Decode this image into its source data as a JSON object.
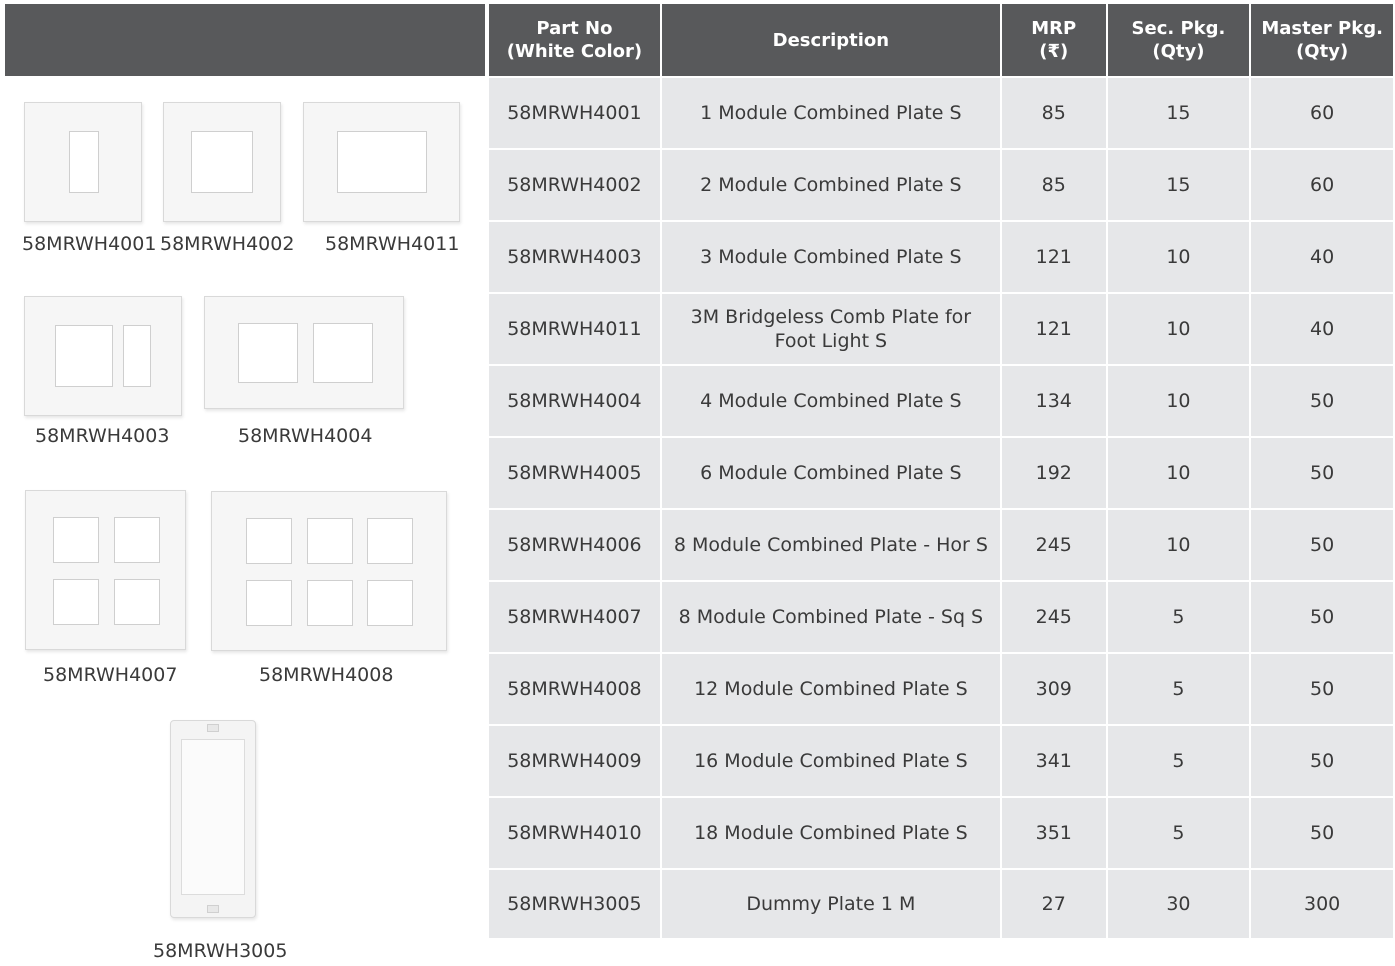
{
  "table": {
    "headers": {
      "part_no": "Part No\n(White Color)",
      "description": "Description",
      "mrp": "MRP\n(₹)",
      "sec_pkg": "Sec. Pkg.\n(Qty)",
      "master_pkg": "Master Pkg.\n(Qty)"
    },
    "rows": [
      {
        "part_no": "58MRWH4001",
        "description": "1 Module Combined Plate S",
        "mrp": "85",
        "sec_pkg": "15",
        "master_pkg": "60"
      },
      {
        "part_no": "58MRWH4002",
        "description": "2 Module Combined Plate S",
        "mrp": "85",
        "sec_pkg": "15",
        "master_pkg": "60"
      },
      {
        "part_no": "58MRWH4003",
        "description": "3 Module Combined Plate S",
        "mrp": "121",
        "sec_pkg": "10",
        "master_pkg": "40"
      },
      {
        "part_no": "58MRWH4011",
        "description": "3M Bridgeless Comb Plate for Foot Light S",
        "mrp": "121",
        "sec_pkg": "10",
        "master_pkg": "40"
      },
      {
        "part_no": "58MRWH4004",
        "description": "4 Module Combined Plate S",
        "mrp": "134",
        "sec_pkg": "10",
        "master_pkg": "50"
      },
      {
        "part_no": "58MRWH4005",
        "description": "6 Module Combined Plate S",
        "mrp": "192",
        "sec_pkg": "10",
        "master_pkg": "50"
      },
      {
        "part_no": "58MRWH4006",
        "description": "8 Module Combined Plate - Hor S",
        "mrp": "245",
        "sec_pkg": "10",
        "master_pkg": "50"
      },
      {
        "part_no": "58MRWH4007",
        "description": "8 Module Combined Plate - Sq S",
        "mrp": "245",
        "sec_pkg": "5",
        "master_pkg": "50"
      },
      {
        "part_no": "58MRWH4008",
        "description": "12 Module Combined Plate S",
        "mrp": "309",
        "sec_pkg": "5",
        "master_pkg": "50"
      },
      {
        "part_no": "58MRWH4009",
        "description": "16 Module Combined Plate S",
        "mrp": "341",
        "sec_pkg": "5",
        "master_pkg": "50"
      },
      {
        "part_no": "58MRWH4010",
        "description": "18 Module Combined Plate S",
        "mrp": "351",
        "sec_pkg": "5",
        "master_pkg": "50"
      },
      {
        "part_no": "58MRWH3005",
        "description": "Dummy Plate 1 M",
        "mrp": "27",
        "sec_pkg": "30",
        "master_pkg": "300"
      }
    ]
  },
  "products": {
    "captions": {
      "p4001": "58MRWH4001",
      "p4002": "58MRWH4002",
      "p4011": "58MRWH4011",
      "p4003": "58MRWH4003",
      "p4004": "58MRWH4004",
      "p4007": "58MRWH4007",
      "p4008": "58MRWH4008",
      "p3005": "58MRWH3005"
    }
  },
  "colors": {
    "header_bg": "#58595b",
    "header_text": "#ffffff",
    "cell_bg": "#e6e7e9",
    "text": "#3a3a3a"
  }
}
